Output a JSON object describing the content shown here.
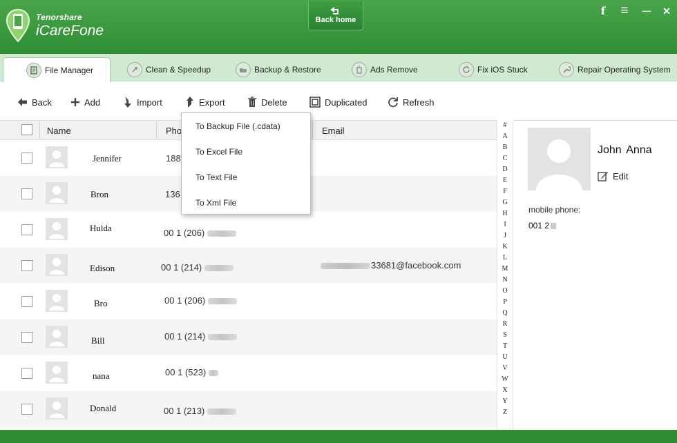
{
  "app": {
    "brand_small": "Tenorshare",
    "brand_name": "iCareFone",
    "back_home": "Back home",
    "accent": "#2f8e35"
  },
  "window_controls": [
    {
      "icon": "facebook-icon",
      "glyph": "f"
    },
    {
      "icon": "menu-icon",
      "glyph": "≡"
    },
    {
      "icon": "minimize-icon",
      "glyph": "—"
    },
    {
      "icon": "close-icon",
      "glyph": "✕"
    }
  ],
  "tabs": [
    {
      "label": "File Manager",
      "icon": "file-manager-icon",
      "active": true
    },
    {
      "label": "Clean & Speedup",
      "icon": "rocket-icon"
    },
    {
      "label": "Backup & Restore",
      "icon": "backup-icon"
    },
    {
      "label": "Ads Remove",
      "icon": "trash-icon"
    },
    {
      "label": "Fix iOS Stuck",
      "icon": "refresh-icon"
    },
    {
      "label": "Repair Operating System",
      "icon": "wrench-icon"
    }
  ],
  "toolbar": {
    "back": "Back",
    "add": "Add",
    "import": "Import",
    "export": "Export",
    "delete": "Delete",
    "duplicated": "Duplicated",
    "refresh": "Refresh"
  },
  "table": {
    "columns": {
      "name": "Name",
      "phone": "Pho",
      "email": "Email"
    },
    "rows": [
      {
        "name": "Jennifer",
        "phone": "188",
        "email": ""
      },
      {
        "name": "Bron",
        "phone": "136",
        "email": ""
      },
      {
        "name": "Hulda",
        "phone": "00 1 (206)",
        "email": ""
      },
      {
        "name": "Edison",
        "phone": "00 1 (214)",
        "email": "33681@facebook.com"
      },
      {
        "name": "Bro",
        "phone": "00 1 (206)",
        "email": ""
      },
      {
        "name": "Bill",
        "phone": "00 1 (214)",
        "email": ""
      },
      {
        "name": "nana",
        "phone": "00 1 (523)",
        "email": ""
      },
      {
        "name": "Donald",
        "phone": "00 1 (213)",
        "email": ""
      }
    ]
  },
  "export_menu": [
    "To Backup File (.cdata)",
    "To Excel File",
    "To Text File",
    "To Xml File"
  ],
  "alphabet": [
    "#",
    "A",
    "B",
    "C",
    "D",
    "E",
    "F",
    "G",
    "H",
    "I",
    "J",
    "K",
    "L",
    "M",
    "N",
    "O",
    "P",
    "Q",
    "R",
    "S",
    "T",
    "U",
    "V",
    "W",
    "X",
    "Y",
    "Z"
  ],
  "detail": {
    "name": "John  Anna",
    "edit": "Edit",
    "phone_label": "mobile phone:",
    "phone_value": "001 2"
  }
}
